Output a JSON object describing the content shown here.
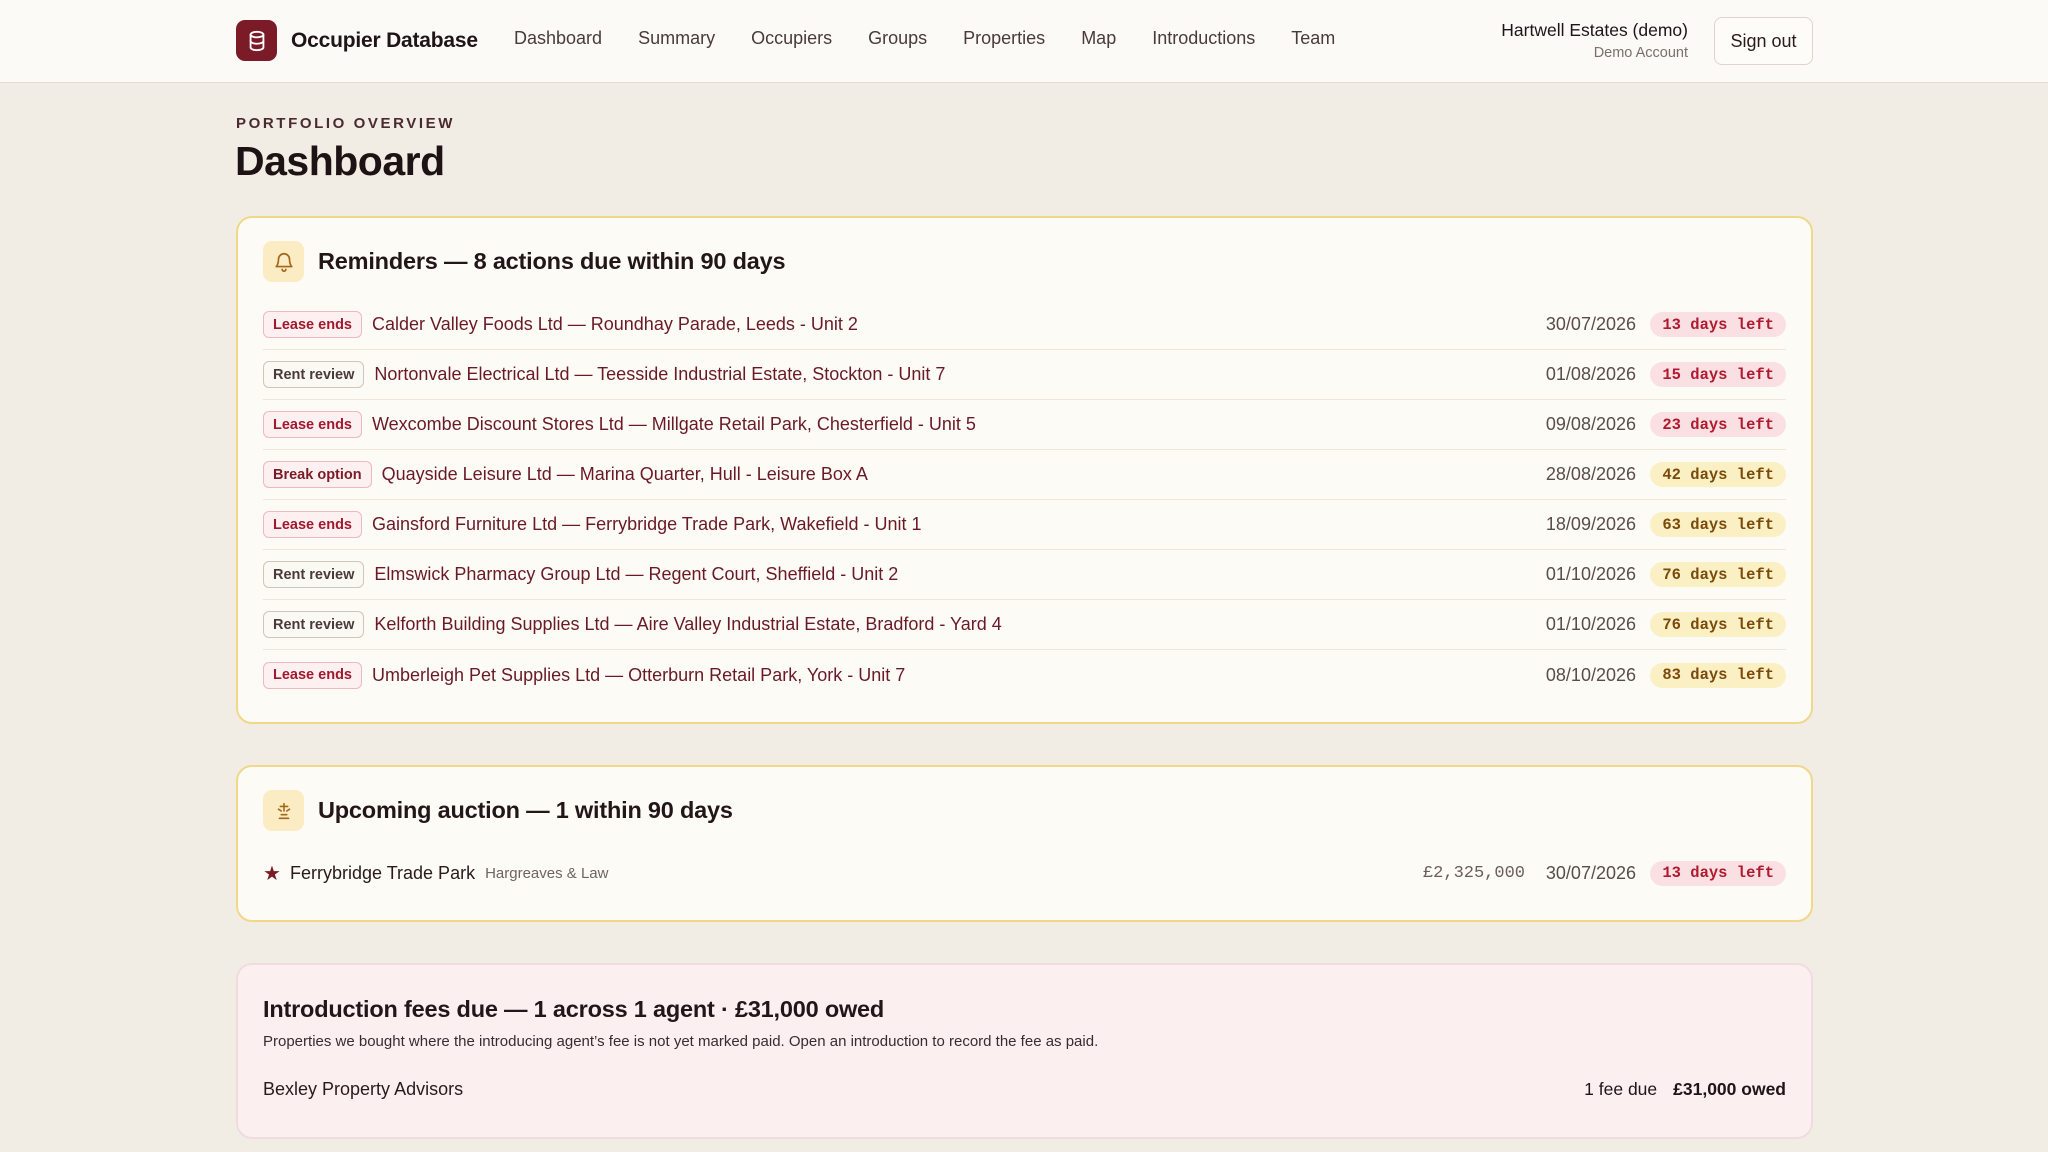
{
  "app": {
    "name": "Occupier Database",
    "logo_icon": "database-icon"
  },
  "nav": {
    "items": [
      "Dashboard",
      "Summary",
      "Occupiers",
      "Groups",
      "Properties",
      "Map",
      "Introductions",
      "Team"
    ]
  },
  "account": {
    "name": "Hartwell Estates (demo)",
    "subtitle": "Demo Account",
    "sign_out_label": "Sign out"
  },
  "page": {
    "eyebrow": "PORTFOLIO OVERVIEW",
    "title": "Dashboard"
  },
  "reminders": {
    "icon": "bell-icon",
    "title": "Reminders — 8 actions due within 90 days",
    "items": [
      {
        "type": "Lease ends",
        "kind": "lease",
        "text": "Calder Valley Foods Ltd — Roundhay Parade, Leeds - Unit 2",
        "date": "30/07/2026",
        "remaining": "13 days left",
        "urgency": "red"
      },
      {
        "type": "Rent review",
        "kind": "rent",
        "text": "Nortonvale Electrical Ltd — Teesside Industrial Estate, Stockton - Unit 7",
        "date": "01/08/2026",
        "remaining": "15 days left",
        "urgency": "red"
      },
      {
        "type": "Lease ends",
        "kind": "lease",
        "text": "Wexcombe Discount Stores Ltd — Millgate Retail Park, Chesterfield - Unit 5",
        "date": "09/08/2026",
        "remaining": "23 days left",
        "urgency": "red"
      },
      {
        "type": "Break option",
        "kind": "break",
        "text": "Quayside Leisure Ltd — Marina Quarter, Hull - Leisure Box A",
        "date": "28/08/2026",
        "remaining": "42 days left",
        "urgency": "amber"
      },
      {
        "type": "Lease ends",
        "kind": "lease",
        "text": "Gainsford Furniture Ltd — Ferrybridge Trade Park, Wakefield - Unit 1",
        "date": "18/09/2026",
        "remaining": "63 days left",
        "urgency": "amber"
      },
      {
        "type": "Rent review",
        "kind": "rent",
        "text": "Elmswick Pharmacy Group Ltd — Regent Court, Sheffield - Unit 2",
        "date": "01/10/2026",
        "remaining": "76 days left",
        "urgency": "amber"
      },
      {
        "type": "Rent review",
        "kind": "rent",
        "text": "Kelforth Building Supplies Ltd — Aire Valley Industrial Estate, Bradford - Yard 4",
        "date": "01/10/2026",
        "remaining": "76 days left",
        "urgency": "amber"
      },
      {
        "type": "Lease ends",
        "kind": "lease",
        "text": "Umberleigh Pet Supplies Ltd — Otterburn Retail Park, York - Unit 7",
        "date": "08/10/2026",
        "remaining": "83 days left",
        "urgency": "amber"
      }
    ]
  },
  "auction": {
    "icon": "gavel-icon",
    "title": "Upcoming auction — 1 within 90 days",
    "item": {
      "star_icon": "star-icon",
      "name": "Ferrybridge Trade Park",
      "agent": "Hargreaves & Law",
      "price": "£2,325,000",
      "date": "30/07/2026",
      "remaining": "13 days left"
    }
  },
  "fees": {
    "title": "Introduction fees due — 1 across 1 agent · £31,000 owed",
    "description": "Properties we bought where the introducing agent’s fee is not yet marked paid. Open an introduction to record the fee as paid.",
    "agent": "Bexley Property Advisors",
    "count": "1 fee due",
    "owed": "£31,000 owed"
  },
  "colors": {
    "brand": "#7a1b27",
    "background": "#f2ede4",
    "card_border": "#f0d78a",
    "urgent_pill": "#fbe0e3",
    "soon_pill": "#fbefc4"
  }
}
